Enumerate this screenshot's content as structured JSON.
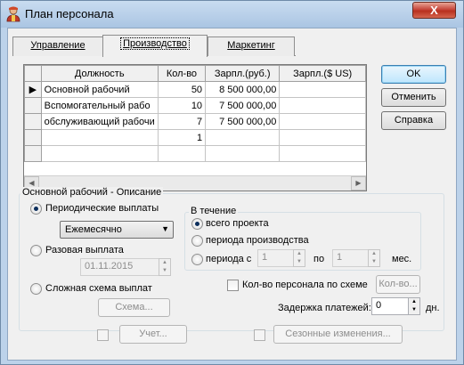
{
  "window": {
    "title": "План персонала",
    "close_glyph": "X"
  },
  "tabs": [
    {
      "label": "Управление"
    },
    {
      "label": "Производство"
    },
    {
      "label": "Маркетинг"
    }
  ],
  "grid": {
    "columns": [
      "Должность",
      "Кол-во",
      "Зарпл.(руб.)",
      "Зарпл.($ US)"
    ],
    "rows": [
      {
        "position": "Основной рабочий",
        "qty": "50",
        "salary_rub": "8 500 000,00",
        "salary_usd": ""
      },
      {
        "position": "Вспомогательный рабо",
        "qty": "10",
        "salary_rub": "7 500 000,00",
        "salary_usd": ""
      },
      {
        "position": "обслуживающий рабочи",
        "qty": "7",
        "salary_rub": "7 500 000,00",
        "salary_usd": ""
      },
      {
        "position": "",
        "qty": "1",
        "salary_rub": "",
        "salary_usd": ""
      }
    ],
    "current_row_marker": "▶"
  },
  "buttons": {
    "ok": "OK",
    "cancel": "Отменить",
    "help": "Справка"
  },
  "description": {
    "group_label": "Основной рабочий - Описание",
    "periodic_label": "Периодические выплаты",
    "periodic_select": "Ежемесячно",
    "oneoff_label": "Разовая выплата",
    "oneoff_date": "01.11.2015",
    "complex_label": "Сложная схема выплат",
    "scheme_button": "Схема...",
    "during": {
      "group_label": "В течение",
      "whole_project": "всего проекта",
      "production_period": "периода производства",
      "period_from": "периода с",
      "from_value": "1",
      "to_label": "по",
      "to_value": "1",
      "unit": "мес."
    },
    "staff_by_scheme_label": "Кол-во персонала по схеме",
    "qty_button": "Кол-во...",
    "delay_label": "Задержка платежей:",
    "delay_value": "0",
    "delay_unit": "дн."
  },
  "footer": {
    "accounting_button": "Учет...",
    "seasonal_button": "Сезонные изменения..."
  }
}
